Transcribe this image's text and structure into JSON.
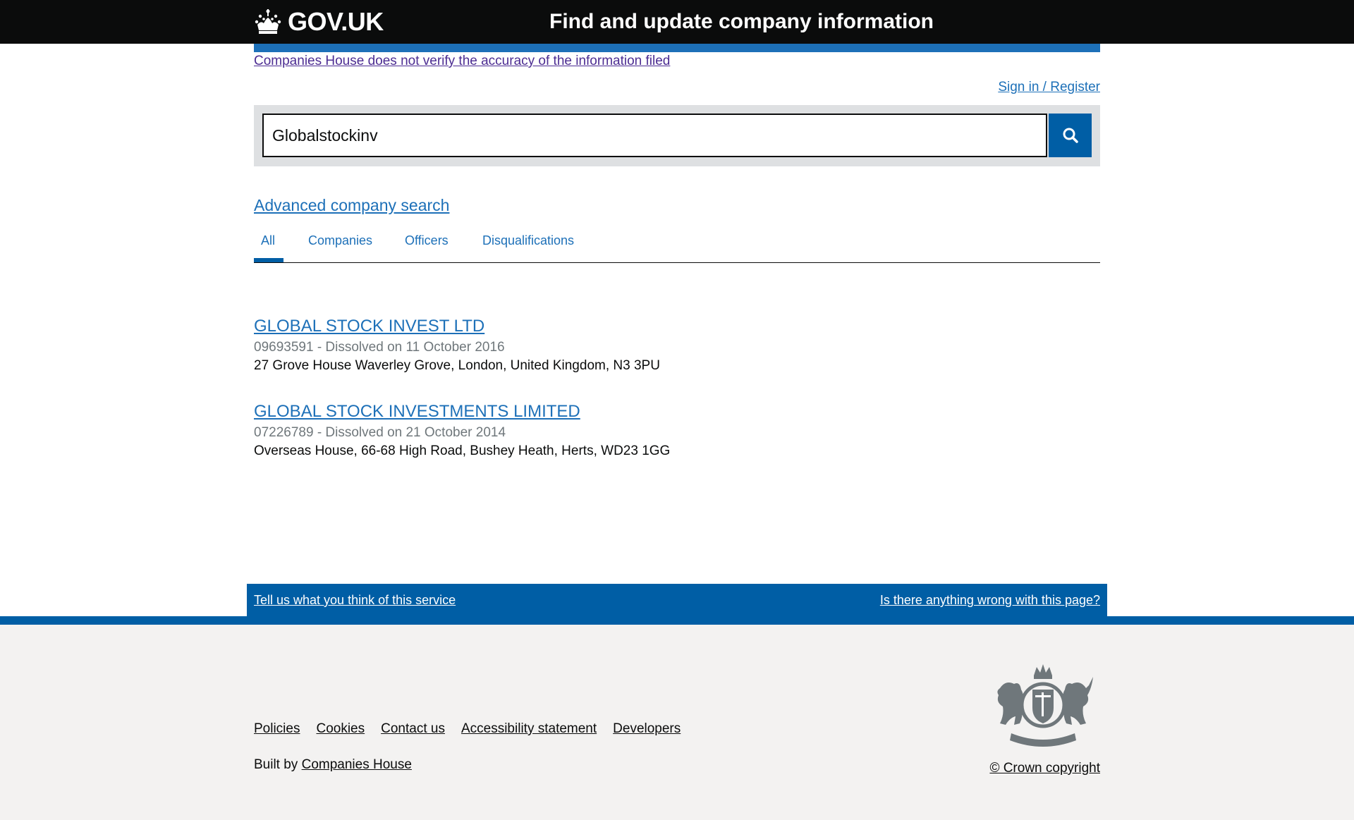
{
  "header": {
    "logo_text": "GOV.UK",
    "service_name": "Find and update company information"
  },
  "disclaimer": "Companies House does not verify the accuracy of the information filed",
  "signin": "Sign in / Register",
  "search": {
    "value": "Globalstockinv"
  },
  "advanced_search": "Advanced company search",
  "tabs": [
    {
      "label": "All",
      "active": true
    },
    {
      "label": "Companies",
      "active": false
    },
    {
      "label": "Officers",
      "active": false
    },
    {
      "label": "Disqualifications",
      "active": false
    }
  ],
  "results": [
    {
      "name": "GLOBAL STOCK INVEST LTD",
      "meta": "09693591 - Dissolved on 11 October 2016",
      "address": "27 Grove House Waverley Grove, London, United Kingdom, N3 3PU"
    },
    {
      "name": "GLOBAL STOCK INVESTMENTS LIMITED",
      "meta": "07226789 - Dissolved on 21 October 2014",
      "address": "Overseas House, 66-68 High Road, Bushey Heath, Herts, WD23 1GG"
    }
  ],
  "feedback": {
    "left": "Tell us what you think of this service",
    "right": "Is there anything wrong with this page?"
  },
  "footer": {
    "links": [
      "Policies",
      "Cookies",
      "Contact us",
      "Accessibility statement",
      "Developers"
    ],
    "built_by_prefix": "Built by",
    "built_by_link": "Companies House",
    "copyright": "© Crown copyright"
  },
  "icons": {
    "logo": "crown-icon",
    "search": "search-icon",
    "crest": "royal-coat-of-arms-icon"
  },
  "colors": {
    "header_bg": "#0b0c0c",
    "link": "#1d70b8",
    "brand_blue": "#005ea5",
    "footer_bg": "#f3f2f1",
    "visited_link": "#4c2c92"
  }
}
